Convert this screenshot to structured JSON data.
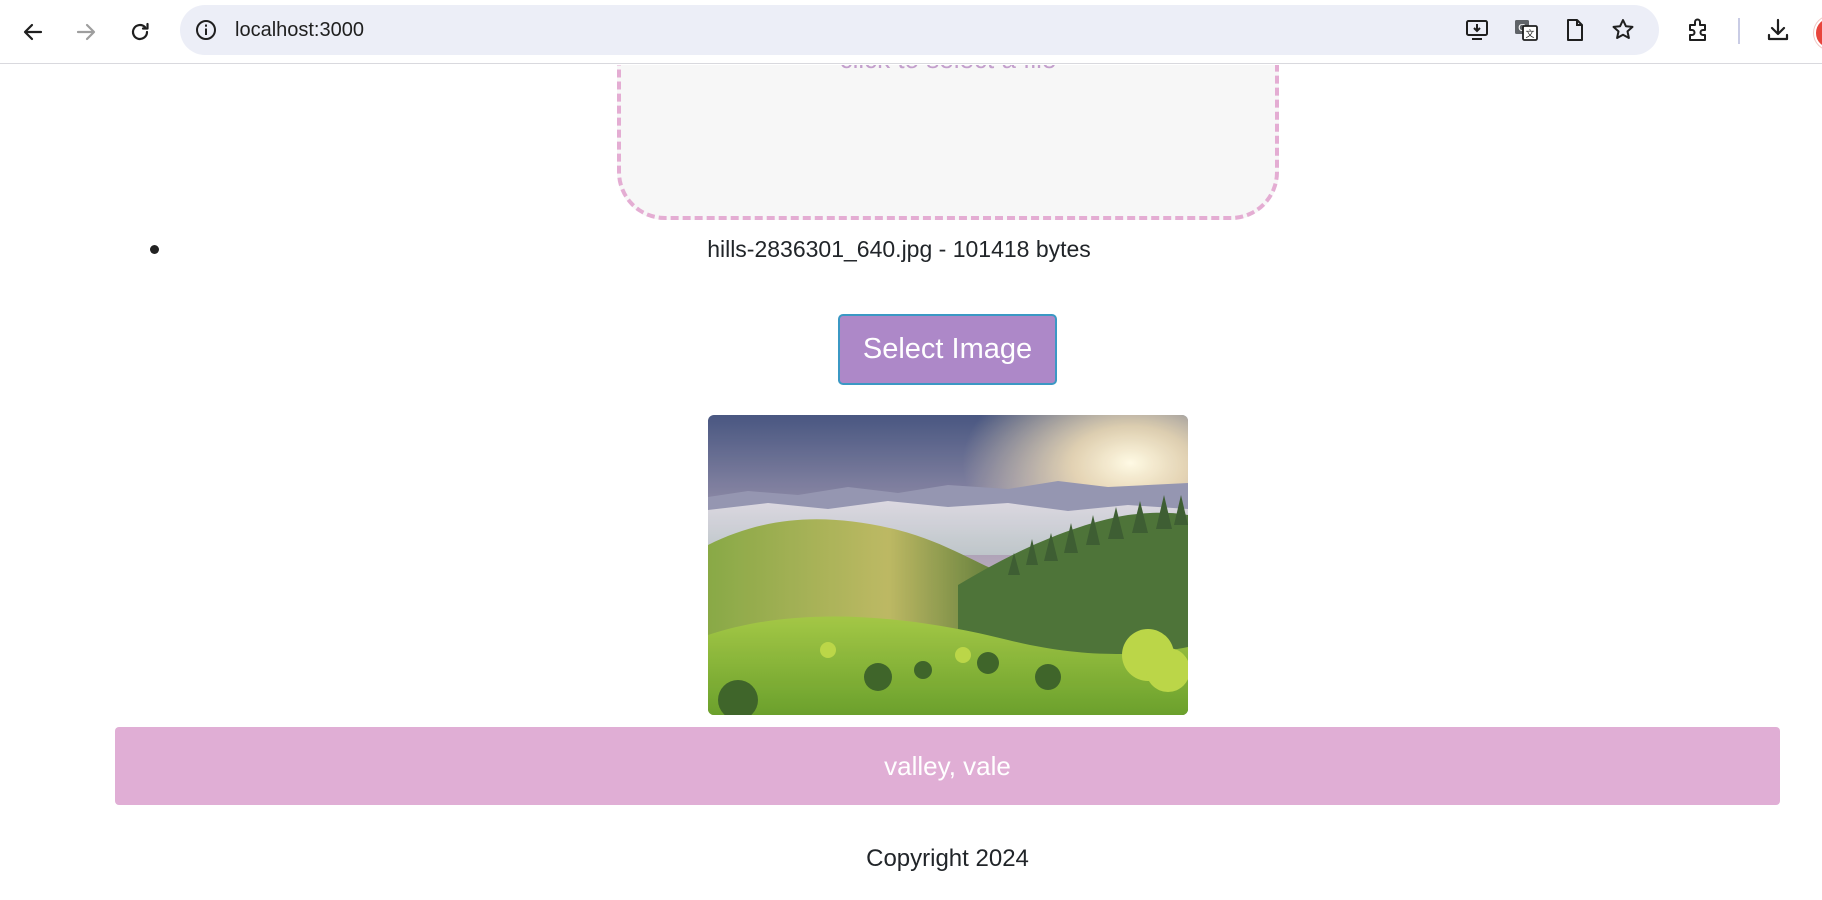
{
  "browser": {
    "url": "localhost:3000"
  },
  "upload": {
    "dropzone_text": "click to select a file",
    "file_entry": "hills-2836301_640.jpg - 101418 bytes",
    "select_button_label": "Select Image"
  },
  "result": {
    "label": "valley, vale"
  },
  "footer": {
    "copyright": "Copyright 2024"
  },
  "colors": {
    "dropzone_border": "#e4add3",
    "select_button_bg": "#ad88c8",
    "result_bar_bg": "#e0aed5"
  }
}
